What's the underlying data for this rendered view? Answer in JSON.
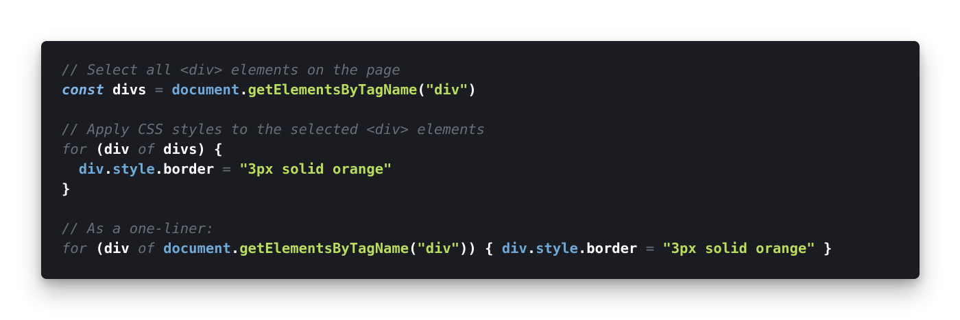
{
  "code": {
    "lines": [
      [
        {
          "t": "// Select all <div> elements on the page",
          "k": "comment"
        }
      ],
      [
        {
          "t": "const",
          "k": "kw-const"
        },
        {
          "t": " divs ",
          "k": "ident"
        },
        {
          "t": "=",
          "k": "op"
        },
        {
          "t": " ",
          "k": "punc"
        },
        {
          "t": "document",
          "k": "obj"
        },
        {
          "t": ".",
          "k": "punc"
        },
        {
          "t": "getElementsByTagName",
          "k": "fn"
        },
        {
          "t": "(",
          "k": "punc"
        },
        {
          "t": "\"div\"",
          "k": "str"
        },
        {
          "t": ")",
          "k": "punc"
        }
      ],
      [],
      [
        {
          "t": "// Apply CSS styles to the selected <div> elements",
          "k": "comment"
        }
      ],
      [
        {
          "t": "for",
          "k": "kw"
        },
        {
          "t": " (div ",
          "k": "punc"
        },
        {
          "t": "of",
          "k": "kw"
        },
        {
          "t": " divs) {",
          "k": "punc"
        }
      ],
      [
        {
          "t": "  ",
          "k": "punc"
        },
        {
          "t": "div",
          "k": "obj"
        },
        {
          "t": ".",
          "k": "punc"
        },
        {
          "t": "style",
          "k": "obj"
        },
        {
          "t": ".border ",
          "k": "punc"
        },
        {
          "t": "=",
          "k": "op"
        },
        {
          "t": " ",
          "k": "punc"
        },
        {
          "t": "\"3px solid orange\"",
          "k": "str"
        }
      ],
      [
        {
          "t": "}",
          "k": "punc"
        }
      ],
      [],
      [
        {
          "t": "// As a one-liner:",
          "k": "comment"
        }
      ],
      [
        {
          "t": "for",
          "k": "kw"
        },
        {
          "t": " (div ",
          "k": "punc"
        },
        {
          "t": "of",
          "k": "kw"
        },
        {
          "t": " ",
          "k": "punc"
        },
        {
          "t": "document",
          "k": "obj"
        },
        {
          "t": ".",
          "k": "punc"
        },
        {
          "t": "getElementsByTagName",
          "k": "fn"
        },
        {
          "t": "(",
          "k": "punc"
        },
        {
          "t": "\"div\"",
          "k": "str"
        },
        {
          "t": ")) { ",
          "k": "punc"
        },
        {
          "t": "div",
          "k": "obj"
        },
        {
          "t": ".",
          "k": "punc"
        },
        {
          "t": "style",
          "k": "obj"
        },
        {
          "t": ".border ",
          "k": "punc"
        },
        {
          "t": "=",
          "k": "op"
        },
        {
          "t": " ",
          "k": "punc"
        },
        {
          "t": "\"3px solid orange\"",
          "k": "str"
        },
        {
          "t": " }",
          "k": "punc"
        }
      ]
    ]
  },
  "colors": {
    "background": "#ffffff",
    "card": "#1a1c22",
    "comment": "#6b6e76",
    "keyword_const": "#7fb6e6",
    "object": "#6fa9d8",
    "function": "#b9dd5c",
    "string": "#b9dd5c",
    "text": "#ffffff"
  }
}
